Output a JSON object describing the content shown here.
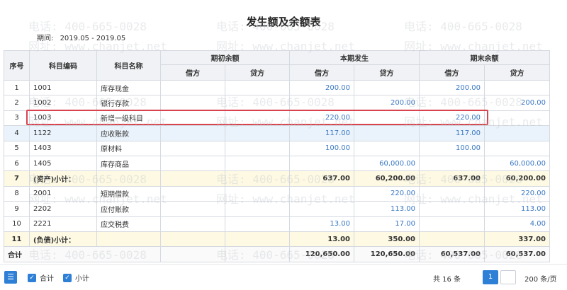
{
  "title": "发生额及余额表",
  "period": {
    "label": "期间:",
    "value": "2019.05 - 2019.05"
  },
  "headers": {
    "seq": "序号",
    "code": "科目编码",
    "name": "科目名称",
    "opening": "期初余额",
    "current": "本期发生",
    "closing": "期末余额",
    "debit": "借方",
    "credit": "贷方"
  },
  "rows": [
    {
      "seq": "1",
      "code": "1001",
      "name": "库存现金",
      "od": "",
      "oc": "",
      "cd": "200.00",
      "cc": "",
      "ed": "200.00",
      "ec": ""
    },
    {
      "seq": "2",
      "code": "1002",
      "name": "银行存款",
      "od": "",
      "oc": "",
      "cd": "",
      "cc": "200.00",
      "ed": "",
      "ec": "200.00"
    },
    {
      "seq": "3",
      "code": "1003",
      "name": "新增一级科目",
      "od": "",
      "oc": "",
      "cd": "220.00",
      "cc": "",
      "ed": "220.00",
      "ec": ""
    },
    {
      "seq": "4",
      "code": "1122",
      "name": "应收账款",
      "od": "",
      "oc": "",
      "cd": "117.00",
      "cc": "",
      "ed": "117.00",
      "ec": ""
    },
    {
      "seq": "5",
      "code": "1403",
      "name": "原材料",
      "od": "",
      "oc": "",
      "cd": "100.00",
      "cc": "",
      "ed": "100.00",
      "ec": ""
    },
    {
      "seq": "6",
      "code": "1405",
      "name": "库存商品",
      "od": "",
      "oc": "",
      "cd": "",
      "cc": "60,000.00",
      "ed": "",
      "ec": "60,000.00"
    },
    {
      "seq": "7",
      "code": "(资产)小计：",
      "name": "",
      "od": "",
      "oc": "",
      "cd": "637.00",
      "cc": "60,200.00",
      "ed": "637.00",
      "ec": "60,200.00"
    },
    {
      "seq": "8",
      "code": "2001",
      "name": "短期借款",
      "od": "",
      "oc": "",
      "cd": "",
      "cc": "220.00",
      "ed": "",
      "ec": "220.00"
    },
    {
      "seq": "9",
      "code": "2202",
      "name": "应付账款",
      "od": "",
      "oc": "",
      "cd": "",
      "cc": "113.00",
      "ed": "",
      "ec": "113.00"
    },
    {
      "seq": "10",
      "code": "2221",
      "name": "应交税费",
      "od": "",
      "oc": "",
      "cd": "13.00",
      "cc": "17.00",
      "ed": "",
      "ec": "4.00"
    },
    {
      "seq": "11",
      "code": "(负债)小计：",
      "name": "",
      "od": "",
      "oc": "",
      "cd": "13.00",
      "cc": "350.00",
      "ed": "",
      "ec": "337.00"
    }
  ],
  "total": {
    "label": "合计",
    "od": "",
    "oc": "",
    "cd": "120,650.00",
    "cc": "120,650.00",
    "ed": "60,537.00",
    "ec": "60,537.00"
  },
  "footer": {
    "chk_total": "合计",
    "chk_subtotal": "小计",
    "count": "共 16 条",
    "page": "1",
    "page_size": "200 条/页"
  },
  "watermark": {
    "phone": "电话: 400-665-0028",
    "site": "网址: www.chanjet.net"
  }
}
